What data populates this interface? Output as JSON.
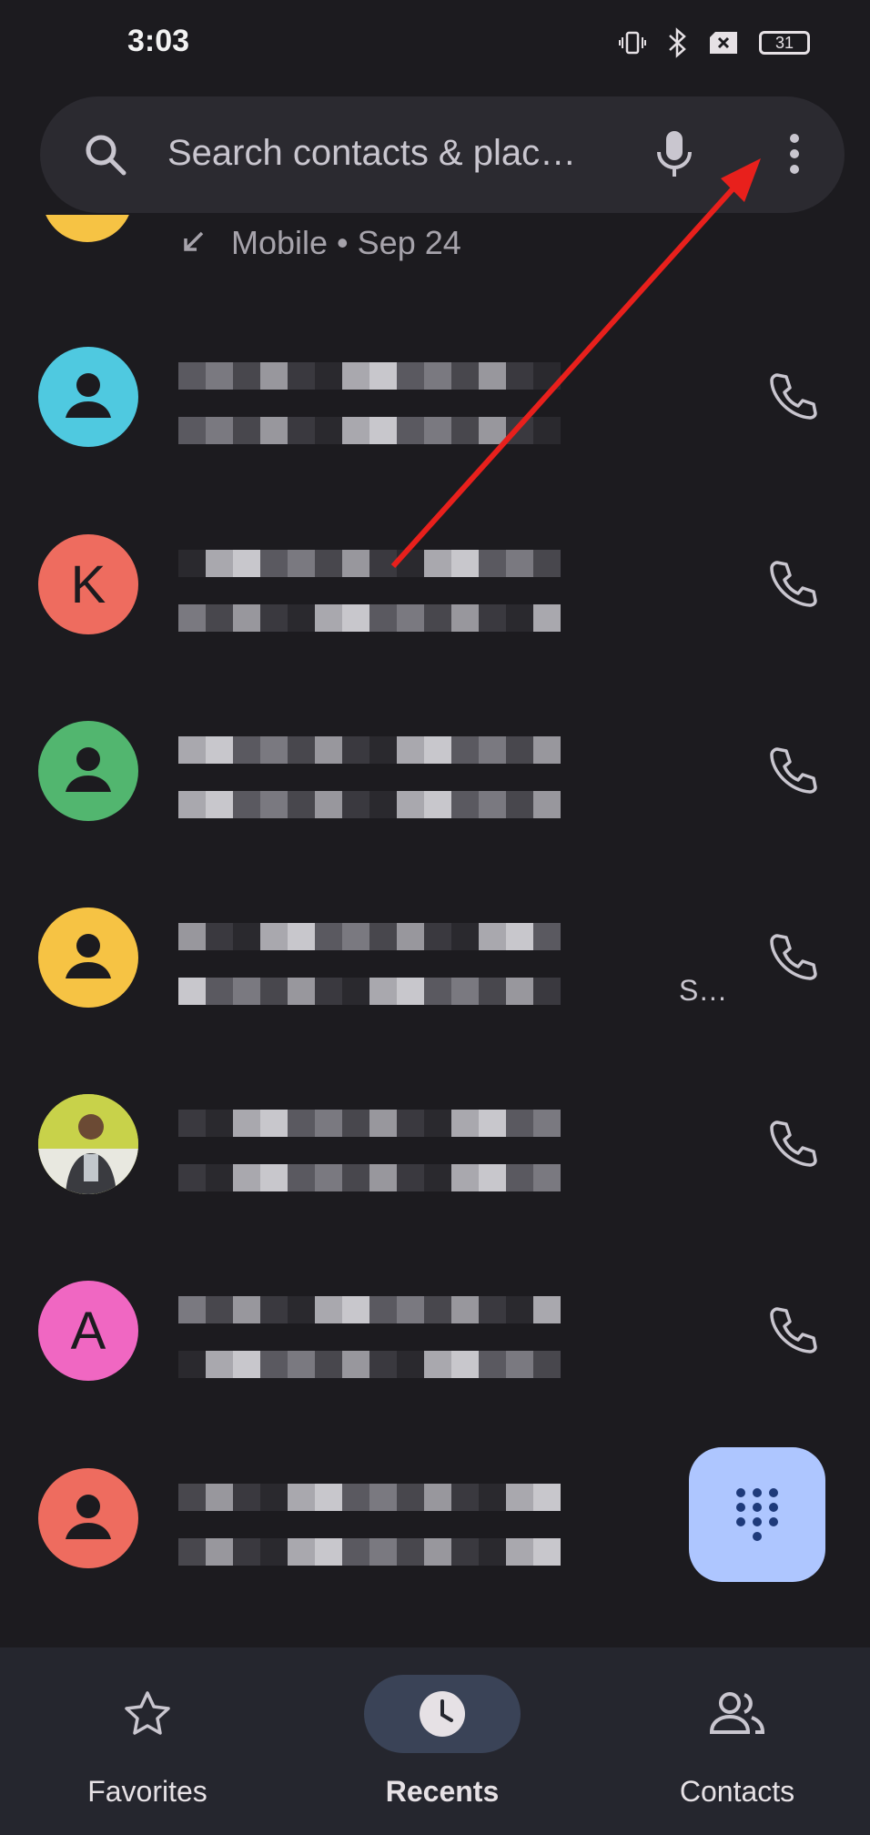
{
  "status_bar": {
    "time": "3:03",
    "battery": "31"
  },
  "search": {
    "placeholder": "Search contacts & plac…"
  },
  "partial_entry": {
    "detail": "Mobile • Sep 24"
  },
  "contacts": [
    {
      "avatar_type": "person-icon",
      "color": "#4fc9e0"
    },
    {
      "avatar_type": "letter",
      "letter": "K",
      "color": "#ee6c5f"
    },
    {
      "avatar_type": "person-icon",
      "color": "#52b66f"
    },
    {
      "avatar_type": "person-icon",
      "color": "#f6c344",
      "suffix": "S…"
    },
    {
      "avatar_type": "photo",
      "color": "#c8d24a"
    },
    {
      "avatar_type": "letter",
      "letter": "A",
      "color": "#f067c2"
    },
    {
      "avatar_type": "person-icon",
      "color": "#ee6c5f"
    }
  ],
  "nav": {
    "favorites": "Favorites",
    "recents": "Recents",
    "contacts": "Contacts"
  },
  "colors": {
    "background": "#1c1b1f",
    "fab": "#aec6ff",
    "nav_active_pill": "#3a4357",
    "annotation_arrow": "#e8201c"
  }
}
